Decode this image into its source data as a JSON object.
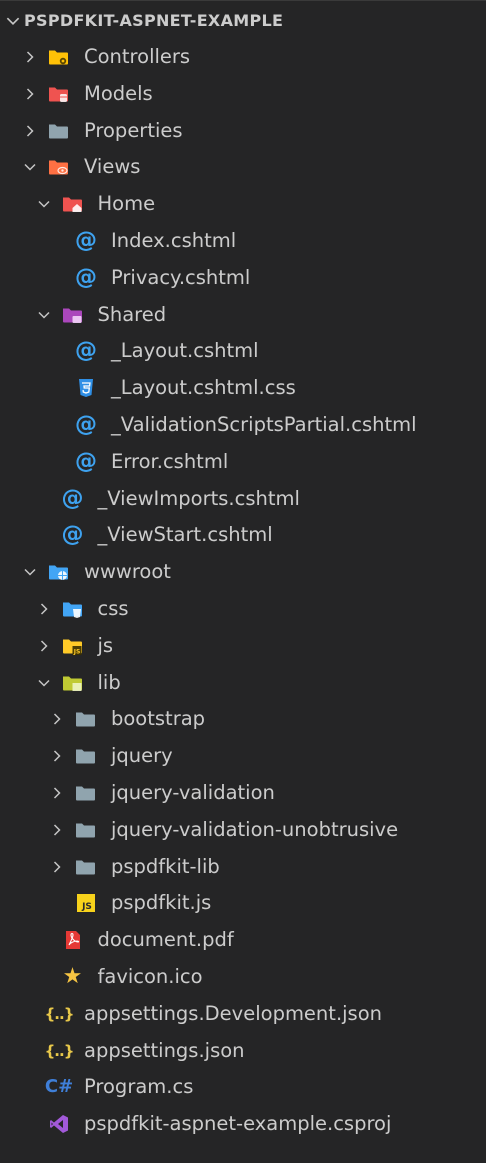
{
  "explorer": {
    "project_title": "PSPDFKIT-ASPNET-EXAMPLE",
    "items": [
      {
        "label": "Controllers",
        "depth": 0,
        "twisty": "right",
        "icon": "folder-controllers-icon"
      },
      {
        "label": "Models",
        "depth": 0,
        "twisty": "right",
        "icon": "folder-models-icon"
      },
      {
        "label": "Properties",
        "depth": 0,
        "twisty": "right",
        "icon": "folder-icon"
      },
      {
        "label": "Views",
        "depth": 0,
        "twisty": "down",
        "icon": "folder-views-icon"
      },
      {
        "label": "Home",
        "depth": 1,
        "twisty": "down",
        "icon": "folder-home-icon"
      },
      {
        "label": "Index.cshtml",
        "depth": 2,
        "twisty": "none",
        "icon": "razor-icon"
      },
      {
        "label": "Privacy.cshtml",
        "depth": 2,
        "twisty": "none",
        "icon": "razor-icon"
      },
      {
        "label": "Shared",
        "depth": 1,
        "twisty": "down",
        "icon": "folder-shared-icon"
      },
      {
        "label": "_Layout.cshtml",
        "depth": 2,
        "twisty": "none",
        "icon": "razor-icon"
      },
      {
        "label": "_Layout.cshtml.css",
        "depth": 2,
        "twisty": "none",
        "icon": "css-icon"
      },
      {
        "label": "_ValidationScriptsPartial.cshtml",
        "depth": 2,
        "twisty": "none",
        "icon": "razor-icon"
      },
      {
        "label": "Error.cshtml",
        "depth": 2,
        "twisty": "none",
        "icon": "razor-icon"
      },
      {
        "label": "_ViewImports.cshtml",
        "depth": 1,
        "twisty": "none",
        "icon": "razor-icon"
      },
      {
        "label": "_ViewStart.cshtml",
        "depth": 1,
        "twisty": "none",
        "icon": "razor-icon"
      },
      {
        "label": "wwwroot",
        "depth": 0,
        "twisty": "down",
        "icon": "folder-www-icon"
      },
      {
        "label": "css",
        "depth": 1,
        "twisty": "right",
        "icon": "folder-css-icon"
      },
      {
        "label": "js",
        "depth": 1,
        "twisty": "right",
        "icon": "folder-js-icon"
      },
      {
        "label": "lib",
        "depth": 1,
        "twisty": "down",
        "icon": "folder-lib-icon"
      },
      {
        "label": "bootstrap",
        "depth": 2,
        "twisty": "right",
        "icon": "folder-icon"
      },
      {
        "label": "jquery",
        "depth": 2,
        "twisty": "right",
        "icon": "folder-icon"
      },
      {
        "label": "jquery-validation",
        "depth": 2,
        "twisty": "right",
        "icon": "folder-icon"
      },
      {
        "label": "jquery-validation-unobtrusive",
        "depth": 2,
        "twisty": "right",
        "icon": "folder-icon"
      },
      {
        "label": "pspdfkit-lib",
        "depth": 2,
        "twisty": "right",
        "icon": "folder-icon"
      },
      {
        "label": "pspdfkit.js",
        "depth": 2,
        "twisty": "none",
        "icon": "js-file-icon"
      },
      {
        "label": "document.pdf",
        "depth": 1,
        "twisty": "none",
        "icon": "pdf-icon"
      },
      {
        "label": "favicon.ico",
        "depth": 1,
        "twisty": "none",
        "icon": "star-icon"
      },
      {
        "label": "appsettings.Development.json",
        "depth": 0,
        "twisty": "none",
        "icon": "json-icon"
      },
      {
        "label": "appsettings.json",
        "depth": 0,
        "twisty": "none",
        "icon": "json-icon"
      },
      {
        "label": "Program.cs",
        "depth": 0,
        "twisty": "none",
        "icon": "csharp-icon"
      },
      {
        "label": "pspdfkit-aspnet-example.csproj",
        "depth": 0,
        "twisty": "none",
        "icon": "csproj-icon"
      }
    ]
  },
  "icon_glyphs": {
    "razor": "@",
    "csharp": "C#",
    "json": "{..}",
    "star": "★",
    "js_badge": "JS"
  },
  "colors": {
    "background": "#252526",
    "text": "#cccccc",
    "folder_default": "#90a4ae",
    "controllers": "#ffc107",
    "models": "#ef5350",
    "views": "#ff7043",
    "home": "#ef5350",
    "shared": "#ab47bc",
    "www": "#42a5f5",
    "css": "#42a5f5",
    "js": "#ffca28",
    "lib": "#c0ca33"
  }
}
